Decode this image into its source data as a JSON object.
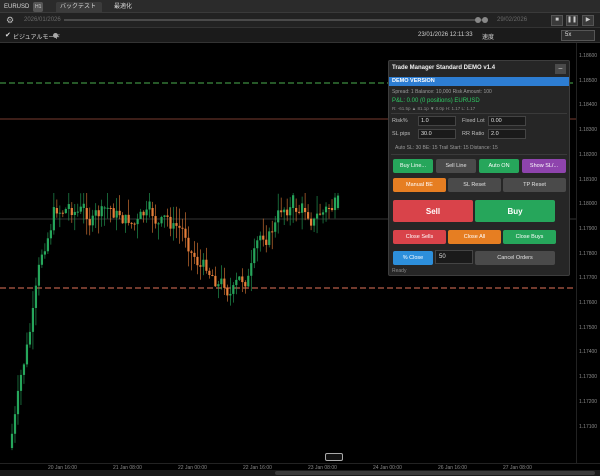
{
  "tabs": [
    {
      "label": "EURUSD",
      "badge": "H1"
    },
    {
      "label": "バックテスト"
    },
    {
      "label": "最適化"
    }
  ],
  "replay": {
    "start_date": "2026/01/2026",
    "end_date": "29/02/2026",
    "controls": [
      "■",
      "❚❚",
      "▶"
    ]
  },
  "toolbar": {
    "visual_mode_label": "ビジュアルモード",
    "sim_time": "23/01/2026 12:11:33",
    "speed_label": "速度",
    "speed_value": "5x"
  },
  "panel": {
    "title": "Trade Manager Standard DEMO v1.4",
    "demo_banner": "DEMO VERSION",
    "info_line1": "Spread: 1    Balance: 10,000  Risk Amount: 100",
    "pnl_line": "P&L: 0.00  (0 positions)  EURUSD",
    "info_line2": "R: -61.5p  ▲ 81.1p  ▼ 0.0p   H: 1.17 L: 1.17",
    "fields": {
      "risk_label": "Risk%",
      "risk_value": "1.0",
      "fixed_lot_label": "Fixed Lot",
      "fixed_lot_value": "0.00",
      "sl_pips_label": "SL pips",
      "sl_pips_value": "30.0",
      "rr_label": "RR Ratio",
      "rr_value": "2.0"
    },
    "auto_line": "Auto SL: 30   BE: 15   Trail Start: 15   Distance: 15",
    "buttons": {
      "buy_line": "Buy Line...",
      "sell_line": "Sell Line",
      "auto_on": "Auto ON",
      "show_sl": "Show SL/...",
      "manual_be": "Manual BE",
      "sl_reset": "SL Reset",
      "tp_reset": "TP Reset",
      "sell": "Sell",
      "buy": "Buy",
      "close_sells": "Close Sells",
      "close_all": "Close All",
      "close_buys": "Close Buys",
      "pct_close": "% Close",
      "cancel_orders": "Cancel Orders"
    },
    "partial_close_value": "50",
    "status": "Ready"
  },
  "price_axis": [
    "1.18600",
    "1.18500",
    "1.18400",
    "1.18300",
    "1.18200",
    "1.18100",
    "1.18000",
    "1.17900",
    "1.17800",
    "1.17700",
    "1.17600",
    "1.17500",
    "1.17400",
    "1.17300",
    "1.17200",
    "1.17100"
  ],
  "time_axis": [
    "20 Jan 16:00",
    "21 Jan 08:00",
    "22 Jan 00:00",
    "22 Jan 16:00",
    "23 Jan 08:00",
    "24 Jan 00:00",
    "26 Jan 16:00",
    "27 Jan 08:00"
  ],
  "colors": {
    "bull": "#26a65b",
    "bear": "#e57e3a",
    "green_level": "#4caf50",
    "red_level": "#e5735a",
    "panel_banner": "#2d7dd2"
  },
  "icons": [
    "gear-icon",
    "checkbox-icon",
    "minimize-icon"
  ]
}
